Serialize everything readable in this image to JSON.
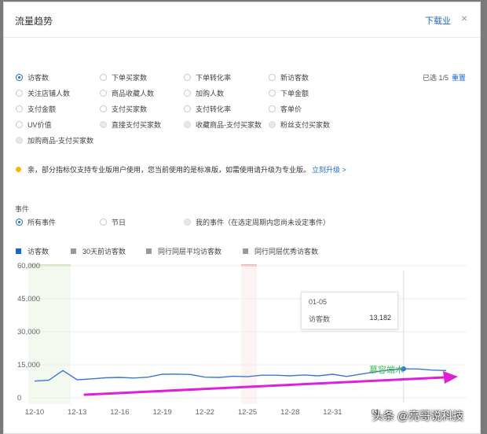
{
  "modal": {
    "title": "流量趋势",
    "download": "下载业",
    "close": "×"
  },
  "metrics": [
    {
      "label": "访客数",
      "checked": true,
      "disabled": false
    },
    {
      "label": "下单买家数",
      "checked": false,
      "disabled": false
    },
    {
      "label": "下单转化率",
      "checked": false,
      "disabled": false
    },
    {
      "label": "新访客数",
      "checked": false,
      "disabled": false
    },
    {
      "label": "关注店铺人数",
      "checked": false,
      "disabled": false
    },
    {
      "label": "商品收藏人数",
      "checked": false,
      "disabled": false
    },
    {
      "label": "加购人数",
      "checked": false,
      "disabled": false
    },
    {
      "label": "下单金额",
      "checked": false,
      "disabled": false
    },
    {
      "label": "支付金额",
      "checked": false,
      "disabled": false
    },
    {
      "label": "支付买家数",
      "checked": false,
      "disabled": false
    },
    {
      "label": "支付转化率",
      "checked": false,
      "disabled": false
    },
    {
      "label": "客单价",
      "checked": false,
      "disabled": false
    },
    {
      "label": "UV价值",
      "checked": false,
      "disabled": false
    },
    {
      "label": "直接支付买家数",
      "checked": false,
      "disabled": true
    },
    {
      "label": "收藏商品-支付买家数",
      "checked": false,
      "disabled": true
    },
    {
      "label": "粉丝支付买家数",
      "checked": false,
      "disabled": true
    },
    {
      "label": "加购商品-支付买家数",
      "checked": false,
      "disabled": true
    }
  ],
  "selection": {
    "text": "已选 1/5",
    "reset": "重置"
  },
  "notice": {
    "text": "亲，部分指标仅支持专业版用户使用，您当前使用的是标准版，如需使用请升级为专业版。",
    "link": "立刻升级 >"
  },
  "events": {
    "label": "事件",
    "options": [
      {
        "label": "所有事件",
        "checked": true,
        "disabled": false
      },
      {
        "label": "节日",
        "checked": false,
        "disabled": false
      },
      {
        "label": "我的事件（在选定周期内您尚未设定事件）",
        "checked": false,
        "disabled": true
      }
    ]
  },
  "tooltip": {
    "date": "01-05",
    "metric": "访客数",
    "value": "13,182"
  },
  "watermarks": {
    "green": "慕容端木",
    "corner": "头条 @亮哥说科技"
  },
  "colors": {
    "accent": "#1a66cc",
    "line": "#3a78d6",
    "legend_gray": "#999999",
    "arrow": "#e020d8"
  },
  "chart_data": {
    "type": "line",
    "legend": [
      {
        "name": "访客数",
        "color": "#1a66cc"
      },
      {
        "name": "30天前访客数",
        "color": "#999999"
      },
      {
        "name": "同行同层平均访客数",
        "color": "#999999"
      },
      {
        "name": "同行同层优秀访客数",
        "color": "#999999"
      }
    ],
    "ylim": [
      0,
      60000
    ],
    "yticks": [
      0,
      15000,
      30000,
      45000,
      60000
    ],
    "ytick_labels": [
      "0",
      "15,000",
      "30,000",
      "45,000",
      "60,000"
    ],
    "xticks": [
      "12-10",
      "12-13",
      "12-16",
      "12-19",
      "12-22",
      "12-25",
      "12-28",
      "12-31",
      "01"
    ],
    "dates": [
      "12-10",
      "12-11",
      "12-12",
      "12-13",
      "12-14",
      "12-15",
      "12-16",
      "12-17",
      "12-18",
      "12-19",
      "12-20",
      "12-21",
      "12-22",
      "12-23",
      "12-24",
      "12-25",
      "12-26",
      "12-27",
      "12-28",
      "12-29",
      "12-30",
      "12-31",
      "01-01",
      "01-02",
      "01-03",
      "01-04",
      "01-05",
      "01-06",
      "01-07",
      "01-08"
    ],
    "series": [
      {
        "name": "访客数",
        "values": [
          7600,
          8000,
          12400,
          8200,
          8600,
          9100,
          9300,
          9000,
          9400,
          10700,
          10800,
          10600,
          9400,
          9300,
          9800,
          9600,
          10300,
          10300,
          10000,
          10400,
          10000,
          10700,
          9700,
          10800,
          11800,
          12700,
          13182,
          13100,
          12600,
          12400
        ]
      }
    ],
    "highlight_index": 26
  }
}
